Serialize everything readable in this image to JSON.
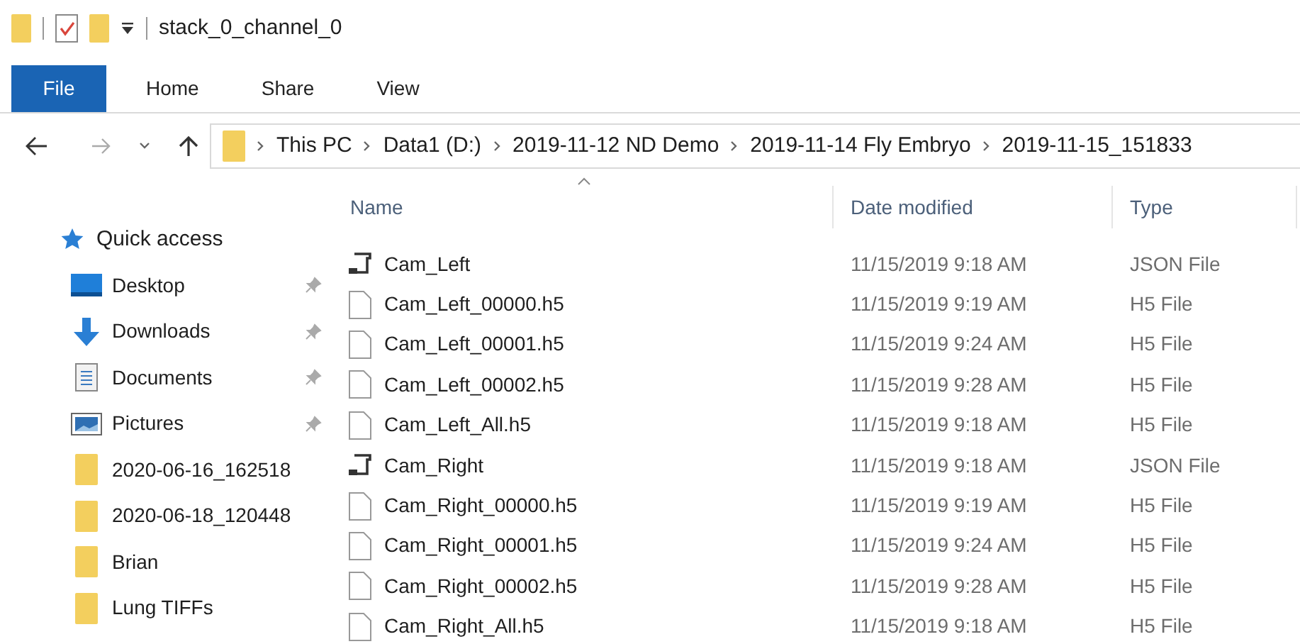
{
  "window": {
    "title": "stack_0_channel_0"
  },
  "ribbon_tabs": [
    {
      "label": "File",
      "selected": true
    },
    {
      "label": "Home",
      "selected": false
    },
    {
      "label": "Share",
      "selected": false
    },
    {
      "label": "View",
      "selected": false
    }
  ],
  "address_bar": {
    "breadcrumbs": [
      "This PC",
      "Data1 (D:)",
      "2019-11-12 ND Demo",
      "2019-11-14 Fly Embryo",
      "2019-11-15_151833"
    ]
  },
  "sidebar": {
    "header": "Quick access",
    "items": [
      {
        "label": "Desktop",
        "kind": "desktop",
        "pinned": true
      },
      {
        "label": "Downloads",
        "kind": "downloads",
        "pinned": true
      },
      {
        "label": "Documents",
        "kind": "documents",
        "pinned": true
      },
      {
        "label": "Pictures",
        "kind": "pictures",
        "pinned": true
      },
      {
        "label": "2020-06-16_162518",
        "kind": "folder",
        "pinned": false
      },
      {
        "label": "2020-06-18_120448",
        "kind": "folder",
        "pinned": false
      },
      {
        "label": "Brian",
        "kind": "folder",
        "pinned": false
      },
      {
        "label": "Lung TIFFs",
        "kind": "folder",
        "pinned": false
      }
    ]
  },
  "file_list": {
    "columns": [
      "Name",
      "Date modified",
      "Type"
    ],
    "rows": [
      {
        "name": "Cam_Left",
        "date_modified": "11/15/2019 9:18 AM",
        "type": "JSON File",
        "kind": "json"
      },
      {
        "name": "Cam_Left_00000.h5",
        "date_modified": "11/15/2019 9:19 AM",
        "type": "H5 File",
        "kind": "file"
      },
      {
        "name": "Cam_Left_00001.h5",
        "date_modified": "11/15/2019 9:24 AM",
        "type": "H5 File",
        "kind": "file"
      },
      {
        "name": "Cam_Left_00002.h5",
        "date_modified": "11/15/2019 9:28 AM",
        "type": "H5 File",
        "kind": "file"
      },
      {
        "name": "Cam_Left_All.h5",
        "date_modified": "11/15/2019 9:18 AM",
        "type": "H5 File",
        "kind": "file"
      },
      {
        "name": "Cam_Right",
        "date_modified": "11/15/2019 9:18 AM",
        "type": "JSON File",
        "kind": "json"
      },
      {
        "name": "Cam_Right_00000.h5",
        "date_modified": "11/15/2019 9:19 AM",
        "type": "H5 File",
        "kind": "file"
      },
      {
        "name": "Cam_Right_00001.h5",
        "date_modified": "11/15/2019 9:24 AM",
        "type": "H5 File",
        "kind": "file"
      },
      {
        "name": "Cam_Right_00002.h5",
        "date_modified": "11/15/2019 9:28 AM",
        "type": "H5 File",
        "kind": "file"
      },
      {
        "name": "Cam_Right_All.h5",
        "date_modified": "11/15/2019 9:18 AM",
        "type": "H5 File",
        "kind": "file"
      }
    ]
  }
}
